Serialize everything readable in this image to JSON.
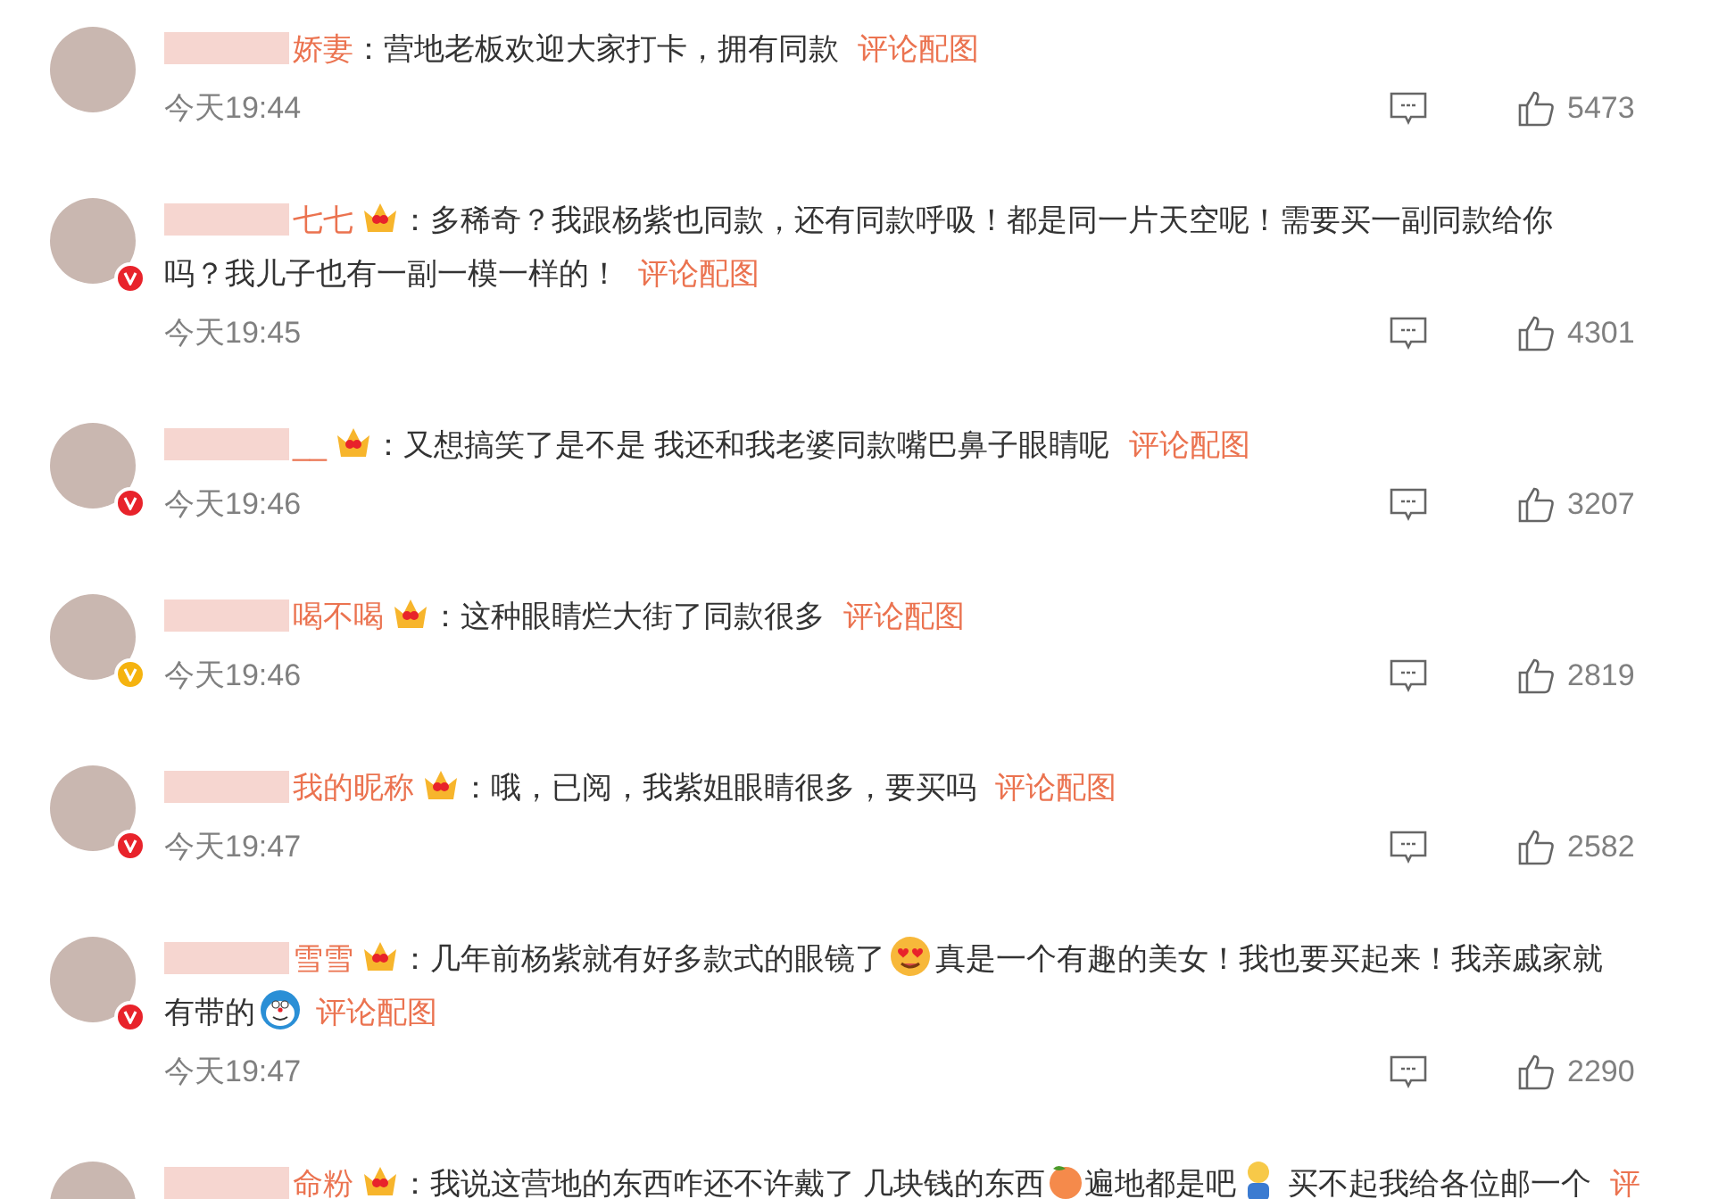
{
  "comments": [
    {
      "name": "娇妻",
      "member_badge": false,
      "parts": [
        {
          "kind": "text",
          "text": "：营地老板欢迎大家打卡，拥有同款 "
        },
        {
          "kind": "link",
          "text": "评论配图"
        }
      ],
      "time": "今天19:44",
      "likes": "5473"
    },
    {
      "name": "七七",
      "member_badge": true,
      "verified": {
        "color": "#e8232b"
      },
      "parts": [
        {
          "kind": "text",
          "text": "：多稀奇？我跟杨紫也同款，还有同款呼吸！都是同一片天空呢！需要买一副同款给你"
        },
        {
          "kind": "break"
        },
        {
          "kind": "text",
          "text": "吗？我儿子也有一副一模一样的！ "
        },
        {
          "kind": "link",
          "text": "评论配图"
        }
      ],
      "time": "今天19:45",
      "likes": "4301"
    },
    {
      "name": "__",
      "member_badge": true,
      "verified": {
        "color": "#e8232b"
      },
      "parts": [
        {
          "kind": "text",
          "text": "：又想搞笑了是不是 我还和我老婆同款嘴巴鼻子眼睛呢 "
        },
        {
          "kind": "link",
          "text": "评论配图"
        }
      ],
      "time": "今天19:46",
      "likes": "3207"
    },
    {
      "name": "喝不喝",
      "member_badge": true,
      "verified": {
        "color": "#f5b30f"
      },
      "parts": [
        {
          "kind": "text",
          "text": "：这种眼睛烂大街了同款很多 "
        },
        {
          "kind": "link",
          "text": "评论配图"
        }
      ],
      "time": "今天19:46",
      "likes": "2819"
    },
    {
      "name": "我的昵称",
      "member_badge": true,
      "verified": {
        "color": "#e8232b"
      },
      "parts": [
        {
          "kind": "text",
          "text": "：哦，已阅，我紫姐眼睛很多，要买吗 "
        },
        {
          "kind": "link",
          "text": "评论配图"
        }
      ],
      "time": "今天19:47",
      "likes": "2582"
    },
    {
      "name": "雪雪",
      "member_badge": true,
      "verified": {
        "color": "#e8232b"
      },
      "parts": [
        {
          "kind": "text",
          "text": "：几年前杨紫就有好多款式的眼镜了"
        },
        {
          "kind": "hearteyes"
        },
        {
          "kind": "text",
          "text": "真是一个有趣的美女！我也要买起来！我亲戚家就"
        },
        {
          "kind": "break"
        },
        {
          "kind": "text",
          "text": "有带的"
        },
        {
          "kind": "cartoon"
        },
        {
          "kind": "link",
          "text": "评论配图"
        }
      ],
      "time": "今天19:47",
      "likes": "2290"
    },
    {
      "name": "命粉",
      "member_badge": true,
      "parts": [
        {
          "kind": "text",
          "text": "：我说这营地的东西咋还不许戴了 几块钱的东西"
        },
        {
          "kind": "peach"
        },
        {
          "kind": "text",
          "text": "遍地都是吧"
        },
        {
          "kind": "figure"
        },
        {
          "kind": "text",
          "text": " 买不起我给各位邮一个 "
        },
        {
          "kind": "link",
          "text": "评"
        }
      ]
    }
  ]
}
